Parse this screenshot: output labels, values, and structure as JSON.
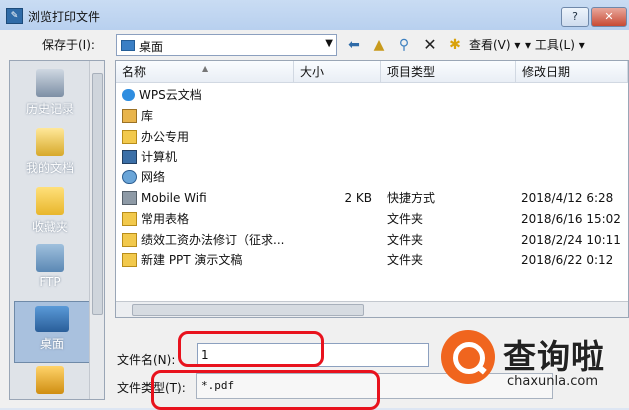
{
  "window": {
    "title": "浏览打印文件",
    "help_glyph": "?",
    "close_glyph": "✕"
  },
  "toolbar": {
    "save_in_label": "保存于(I):",
    "location": "桌面",
    "view_label": "查看(V) ▾",
    "tools_label": "▾ 工具(L) ▾"
  },
  "places": [
    {
      "label": "历史记录",
      "icon": "history-icon"
    },
    {
      "label": "我的文档",
      "icon": "documents-icon"
    },
    {
      "label": "收藏夹",
      "icon": "favorites-icon"
    },
    {
      "label": "FTP",
      "icon": "ftp-icon"
    },
    {
      "label": "桌面",
      "icon": "desktop-icon"
    },
    {
      "label": "",
      "icon": "folder-icon"
    }
  ],
  "columns": [
    "名称",
    "大小",
    "项目类型",
    "修改日期"
  ],
  "files": [
    {
      "name": "WPS云文档",
      "size": "",
      "type": "",
      "date": "",
      "icon": "cloud-icon"
    },
    {
      "name": "库",
      "size": "",
      "type": "",
      "date": "",
      "icon": "library-icon"
    },
    {
      "name": "办公专用",
      "size": "",
      "type": "",
      "date": "",
      "icon": "folder-icon"
    },
    {
      "name": "计算机",
      "size": "",
      "type": "",
      "date": "",
      "icon": "computer-icon"
    },
    {
      "name": "网络",
      "size": "",
      "type": "",
      "date": "",
      "icon": "network-icon"
    },
    {
      "name": "Mobile Wifi",
      "size": "2 KB",
      "type": "快捷方式",
      "date": "2018/4/12 6:28",
      "icon": "shortcut-icon"
    },
    {
      "name": "常用表格",
      "size": "",
      "type": "文件夹",
      "date": "2018/6/16 15:02",
      "icon": "folder-icon"
    },
    {
      "name": "绩效工资办法修订（征求...",
      "size": "",
      "type": "文件夹",
      "date": "2018/2/24 10:11",
      "icon": "folder-icon"
    },
    {
      "name": "新建 PPT 演示文稿",
      "size": "",
      "type": "文件夹",
      "date": "2018/6/22 0:12",
      "icon": "folder-icon"
    }
  ],
  "form": {
    "filename_label": "文件名(N):",
    "filename_value": "1",
    "filetype_label": "文件类型(T):",
    "filetype_value": "*.pdf"
  },
  "watermark": {
    "text": "查询啦",
    "domain": "chaxunla.com"
  }
}
